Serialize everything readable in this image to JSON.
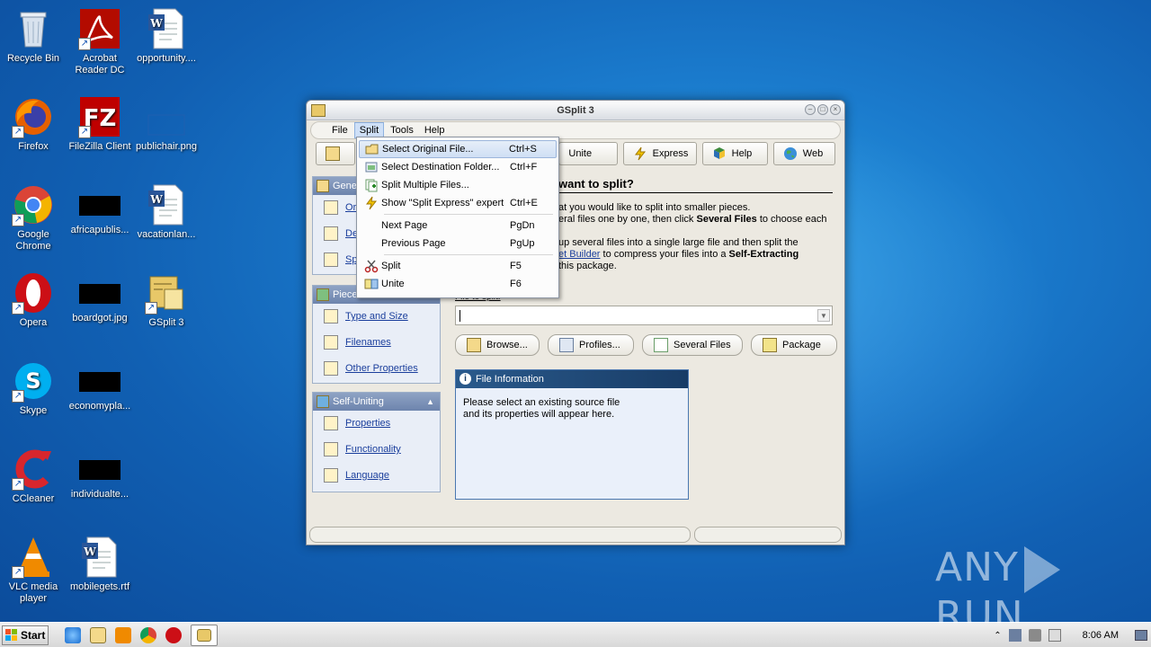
{
  "desktop": {
    "icons": [
      {
        "label": "Recycle Bin",
        "icon": "recycle-bin-icon",
        "color": "#c9d6e6"
      },
      {
        "label": "Acrobat Reader DC",
        "icon": "acrobat-icon",
        "color": "#b30b00"
      },
      {
        "label": "opportunity....",
        "icon": "word-doc-icon",
        "color": "#2a5699"
      },
      {
        "label": "Firefox",
        "icon": "firefox-icon",
        "color": "#e66000"
      },
      {
        "label": "FileZilla Client",
        "icon": "filezilla-icon",
        "color": "#bf0000"
      },
      {
        "label": "publichair.png",
        "icon": "image-file-icon",
        "color": "#1f5fb0"
      },
      {
        "label": "Google Chrome",
        "icon": "chrome-icon",
        "color": "#4285f4"
      },
      {
        "label": "africapublis...",
        "icon": "black-thumbnail-icon",
        "color": "#000000"
      },
      {
        "label": "vacationlan...",
        "icon": "word-doc-icon",
        "color": "#2a5699"
      },
      {
        "label": "Opera",
        "icon": "opera-icon",
        "color": "#cc0f16"
      },
      {
        "label": "boardgot.jpg",
        "icon": "black-thumbnail-icon",
        "color": "#000000"
      },
      {
        "label": "GSplit 3",
        "icon": "gsplit-icon",
        "color": "#e8c868"
      },
      {
        "label": "Skype",
        "icon": "skype-icon",
        "color": "#00aff0"
      },
      {
        "label": "economypla...",
        "icon": "black-thumbnail-icon",
        "color": "#000000"
      },
      {
        "label": "CCleaner",
        "icon": "ccleaner-icon",
        "color": "#d8262d"
      },
      {
        "label": "individualte...",
        "icon": "black-thumbnail-icon",
        "color": "#000000"
      },
      {
        "label": "VLC media player",
        "icon": "vlc-icon",
        "color": "#f08a00"
      },
      {
        "label": "mobilegets.rtf",
        "icon": "word-doc-icon",
        "color": "#2a5699"
      }
    ]
  },
  "window": {
    "title": "GSplit 3",
    "menu": [
      "File",
      "Split",
      "Tools",
      "Help"
    ],
    "toolbar": [
      "Unite",
      "Express",
      "Help",
      "Web"
    ],
    "general_panel": {
      "header": "Gene",
      "items": [
        "Ori",
        "De",
        "Spl"
      ]
    },
    "pieces_panel": {
      "header": "Piece",
      "items": [
        "Type and Size",
        "Filenames",
        "Other Properties"
      ]
    },
    "selfuniting_panel": {
      "header": "Self-Uniting",
      "items": [
        "Properties",
        "Functionality",
        "Language"
      ]
    },
    "main": {
      "heading": "want to split?",
      "line1": "at you would like to split into smaller pieces.",
      "line2a": "eral files one by one, then click ",
      "line2b": "Several Files",
      "line2c": " to choose each",
      "line3": "up several files into a single large file and then split the",
      "line4a": "et Builder",
      "line4b": " to compress your files into a ",
      "line4c": "Self-Extracting",
      "line5": "this package.",
      "file_label": "File to split:",
      "file_value": "",
      "buttons": [
        "Browse...",
        "Profiles...",
        "Several Files",
        "Package"
      ],
      "info_title": "File Information",
      "info_text": "Please select an existing source file and its properties will appear here."
    }
  },
  "split_menu": {
    "items": [
      {
        "label": "Select Original File...",
        "key": "Ctrl+S",
        "icon": "open-file-icon"
      },
      {
        "label": "Select Destination Folder...",
        "key": "Ctrl+F",
        "icon": "folder-icon"
      },
      {
        "label": "Split Multiple Files...",
        "key": "",
        "icon": "multiple-files-icon"
      },
      {
        "label": "Show \"Split Express\" expert",
        "key": "Ctrl+E",
        "icon": "lightning-icon"
      },
      {
        "label": "Next Page",
        "key": "PgDn",
        "icon": ""
      },
      {
        "label": "Previous Page",
        "key": "PgUp",
        "icon": ""
      },
      {
        "label": "Split",
        "key": "F5",
        "icon": "scissors-icon"
      },
      {
        "label": "Unite",
        "key": "F6",
        "icon": "unite-icon"
      }
    ]
  },
  "taskbar": {
    "start": "Start",
    "clock": "8:06 AM",
    "apps": [
      "ie-icon",
      "explorer-icon",
      "media-player-icon",
      "chrome-icon",
      "opera-icon",
      "gsplit-taskbar-icon"
    ]
  },
  "watermark": {
    "left": "ANY",
    "right": "RUN"
  }
}
